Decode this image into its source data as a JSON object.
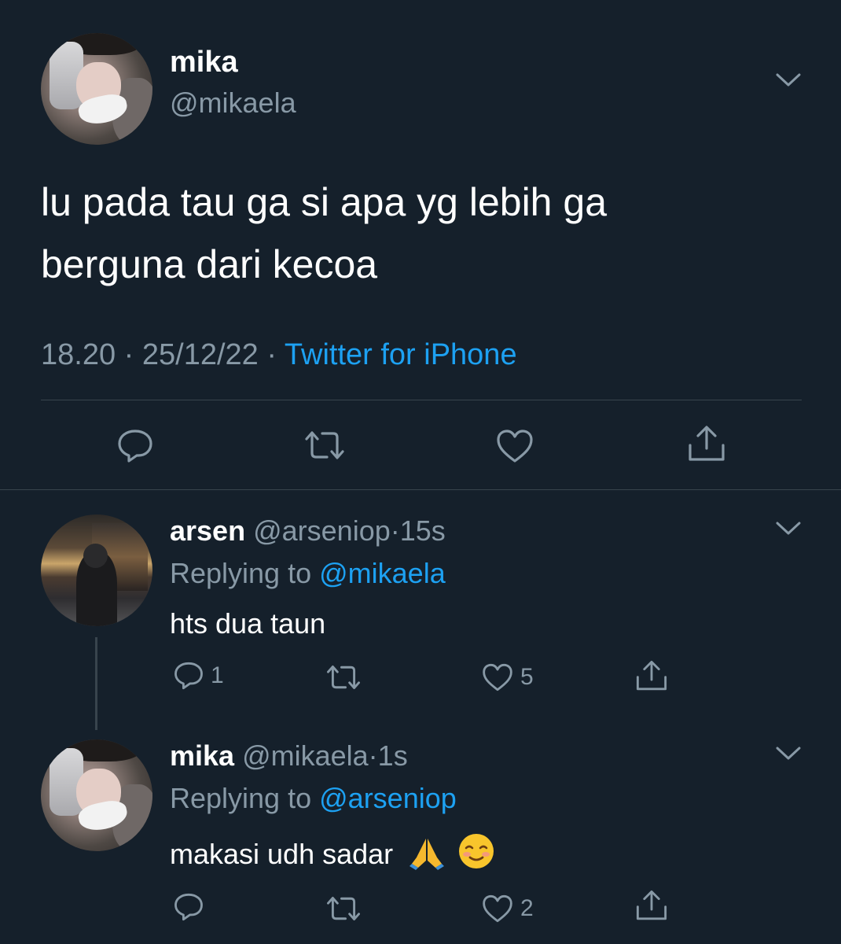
{
  "main_tweet": {
    "display_name": "mika",
    "handle": "@mikaela",
    "text": "lu pada tau ga si apa yg lebih ga berguna dari kecoa",
    "time": "18.20",
    "date": "25/12/22",
    "source": "Twitter for iPhone",
    "separator": "·"
  },
  "replies": [
    {
      "display_name": "arsen",
      "handle": "@arseniop",
      "time_ago": "15s",
      "replying_label": "Replying to",
      "replying_to": "@mikaela",
      "text": "hts dua taun",
      "reply_count": "1",
      "retweet_count": "",
      "like_count": "5"
    },
    {
      "display_name": "mika",
      "handle": "@mikaela",
      "time_ago": "1s",
      "replying_label": "Replying to",
      "replying_to": "@arseniop",
      "text": "makasi udh sadar",
      "emojis": [
        "folded-hands-emoji",
        "smiling-face-emoji"
      ],
      "reply_count": "",
      "retweet_count": "",
      "like_count": "2"
    }
  ],
  "colors": {
    "background": "#15202b",
    "text": "#ffffff",
    "muted": "#8899a6",
    "link": "#1da1f2",
    "divider": "#38444d"
  },
  "icons": [
    "chevron-down-icon",
    "reply-icon",
    "retweet-icon",
    "like-icon",
    "share-icon"
  ]
}
